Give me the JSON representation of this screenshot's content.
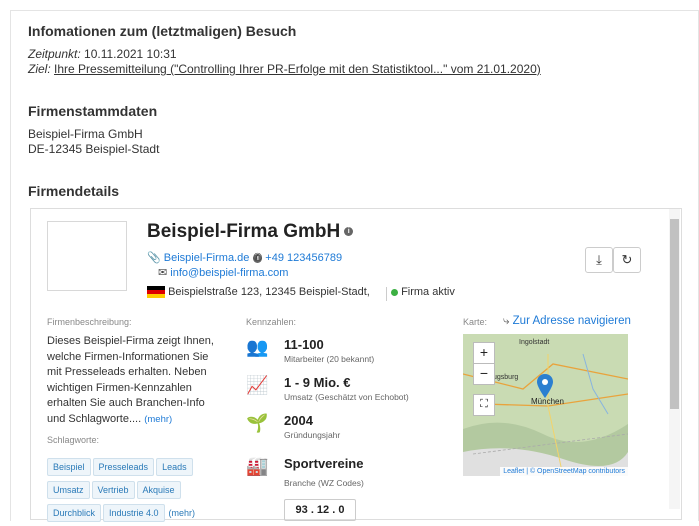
{
  "visit": {
    "heading": "Infomationen zum (letztmaligen) Besuch",
    "time_label": "Zeitpunkt:",
    "time_value": "10.11.2021 10:31",
    "goal_label": "Ziel:",
    "goal_link": "Ihre Pressemitteilung (\"Controlling Ihrer PR-Erfolge mit den Statistiktool...\" vom 21.01.2020)"
  },
  "master": {
    "heading": "Firmenstammdaten",
    "name": "Beispiel-Firma GmbH",
    "city": "DE-12345 Beispiel-Stadt"
  },
  "details": {
    "heading": "Firmendetails",
    "company_name": "Beispiel-Firma GmbH",
    "website": "Beispiel-Firma.de",
    "phone": "+49 123456789",
    "email": "info@beispiel-firma.com",
    "address": "Beispielstraße 123, 12345 Beispiel-Stadt,",
    "status": "Firma aktiv",
    "status_color": "#3cb043",
    "desc_label": "Firmenbeschreibung:",
    "description": "Dieses Beispiel-Firma zeigt Ihnen, welche Firmen-Informationen Sie mit Presseleads erhalten. Neben wichtigen Firmen-Kennzahlen erhalten Sie auch Branchen-Info und Schlagworte.... ",
    "desc_more": "(mehr)",
    "tags_label": "Schlagworte:",
    "tags": [
      "Beispiel",
      "Presseleads",
      "Leads",
      "Umsatz",
      "Vertrieb",
      "Akquise",
      "Durchblick",
      "Industrie 4.0"
    ],
    "tags_more": "(mehr)",
    "kpi_label": "Kennzahlen:",
    "kpis": [
      {
        "value": "11-100",
        "sub": "Mitarbeiter (20 bekannt)",
        "icon": "employees-icon"
      },
      {
        "value": "1 - 9 Mio. €",
        "sub": "Umsatz (Geschätzt von Echobot)",
        "icon": "revenue-chart-icon"
      },
      {
        "value": "2004",
        "sub": "Gründungsjahr",
        "icon": "plant-icon"
      },
      {
        "value": "Sportvereine",
        "sub": "Branche (WZ Codes)",
        "icon": "factory-icon"
      }
    ],
    "wz_code": "93 . 12 . 0",
    "map_label": "Karte:",
    "navigate": "Zur Adresse navigieren",
    "map_cities": [
      "Ingolstadt",
      "ugsburg",
      "München"
    ],
    "map_attrib": "Leaflet | © OpenStreetMap contributors",
    "zoom_in": "+",
    "zoom_out": "−"
  }
}
